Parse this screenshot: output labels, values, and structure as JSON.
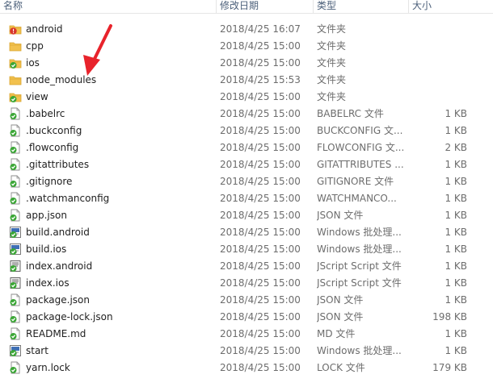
{
  "columns": {
    "name": "名称",
    "date": "修改日期",
    "type": "类型",
    "size": "大小"
  },
  "files": [
    {
      "name": "android",
      "date": "2018/4/25 16:07",
      "type": "文件夹",
      "size": "",
      "icon": "folder-alert-icon"
    },
    {
      "name": "cpp",
      "date": "2018/4/25 15:00",
      "type": "文件夹",
      "size": "",
      "icon": "folder-icon"
    },
    {
      "name": "ios",
      "date": "2018/4/25 15:00",
      "type": "文件夹",
      "size": "",
      "icon": "folder-check-icon"
    },
    {
      "name": "node_modules",
      "date": "2018/4/25 15:53",
      "type": "文件夹",
      "size": "",
      "icon": "folder-icon"
    },
    {
      "name": "view",
      "date": "2018/4/25 15:00",
      "type": "文件夹",
      "size": "",
      "icon": "folder-check-icon"
    },
    {
      "name": ".babelrc",
      "date": "2018/4/25 15:00",
      "type": "BABELRC 文件",
      "size": "1 KB",
      "icon": "file-check-icon"
    },
    {
      "name": ".buckconfig",
      "date": "2018/4/25 15:00",
      "type": "BUCKCONFIG 文...",
      "size": "1 KB",
      "icon": "file-check-icon"
    },
    {
      "name": ".flowconfig",
      "date": "2018/4/25 15:00",
      "type": "FLOWCONFIG 文...",
      "size": "2 KB",
      "icon": "file-check-icon"
    },
    {
      "name": ".gitattributes",
      "date": "2018/4/25 15:00",
      "type": "GITATTRIBUTES ...",
      "size": "1 KB",
      "icon": "file-check-icon"
    },
    {
      "name": ".gitignore",
      "date": "2018/4/25 15:00",
      "type": "GITIGNORE 文件",
      "size": "1 KB",
      "icon": "file-check-icon"
    },
    {
      "name": ".watchmanconfig",
      "date": "2018/4/25 15:00",
      "type": "WATCHMANCO...",
      "size": "1 KB",
      "icon": "file-check-icon"
    },
    {
      "name": "app.json",
      "date": "2018/4/25 15:00",
      "type": "JSON 文件",
      "size": "1 KB",
      "icon": "file-check-icon"
    },
    {
      "name": "build.android",
      "date": "2018/4/25 15:00",
      "type": "Windows 批处理...",
      "size": "1 KB",
      "icon": "batch-file-icon"
    },
    {
      "name": "build.ios",
      "date": "2018/4/25 15:00",
      "type": "Windows 批处理...",
      "size": "1 KB",
      "icon": "batch-file-icon"
    },
    {
      "name": "index.android",
      "date": "2018/4/25 15:00",
      "type": "JScript Script 文件",
      "size": "1 KB",
      "icon": "script-file-icon"
    },
    {
      "name": "index.ios",
      "date": "2018/4/25 15:00",
      "type": "JScript Script 文件",
      "size": "1 KB",
      "icon": "script-file-icon"
    },
    {
      "name": "package.json",
      "date": "2018/4/25 15:00",
      "type": "JSON 文件",
      "size": "1 KB",
      "icon": "file-check-icon"
    },
    {
      "name": "package-lock.json",
      "date": "2018/4/25 15:00",
      "type": "JSON 文件",
      "size": "198 KB",
      "icon": "file-check-icon"
    },
    {
      "name": "README.md",
      "date": "2018/4/25 15:00",
      "type": "MD 文件",
      "size": "1 KB",
      "icon": "file-check-icon"
    },
    {
      "name": "start",
      "date": "2018/4/25 15:00",
      "type": "Windows 批处理...",
      "size": "1 KB",
      "icon": "batch-file-icon"
    },
    {
      "name": "yarn.lock",
      "date": "2018/4/25 15:00",
      "type": "LOCK 文件",
      "size": "179 KB",
      "icon": "file-check-icon"
    }
  ],
  "colors": {
    "folder": "#f2c14e",
    "folder_dark": "#d9a530",
    "check": "#3aa635",
    "alert": "#d9352b",
    "arrow": "#e8232b"
  }
}
